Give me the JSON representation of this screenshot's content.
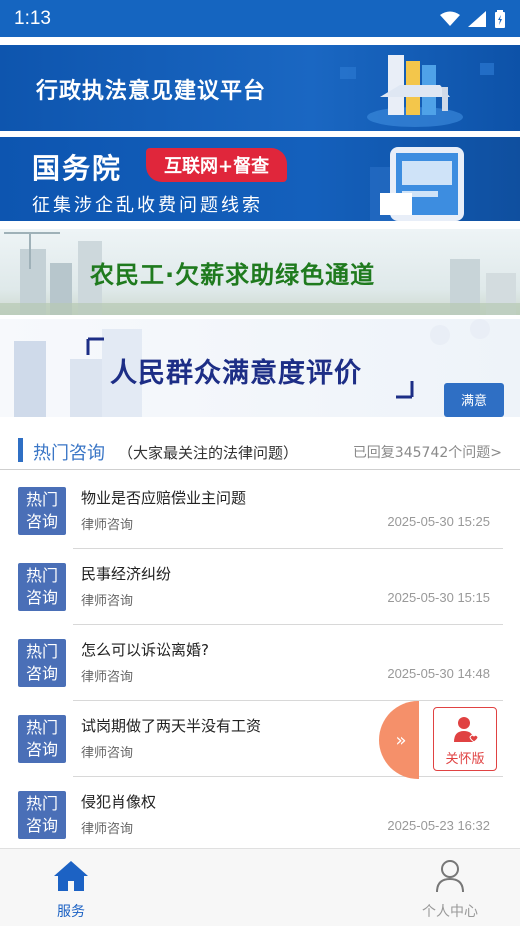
{
  "status_bar": {
    "time": "1:13"
  },
  "banners": [
    {
      "text": "行政执法意见建议平台"
    },
    {
      "title": "国务院",
      "tag": "互联网+督查",
      "subtitle": "征集涉企乱收费问题线索"
    },
    {
      "text": "农民工·欠薪求助绿色通道"
    },
    {
      "text": "人民群众满意度评价",
      "badge_text": "满意"
    }
  ],
  "section": {
    "title": "热门咨询",
    "subtitle": "（大家最关注的法律问题）",
    "count_text": "已回复345742个问题>"
  },
  "consultations": [
    {
      "badge": "热门咨询",
      "question": "物业是否应赔偿业主问题",
      "source": "律师咨询",
      "time": "2025-05-30 15:25"
    },
    {
      "badge": "热门咨询",
      "question": "民事经济纠纷",
      "source": "律师咨询",
      "time": "2025-05-30 15:15"
    },
    {
      "badge": "热门咨询",
      "question": "怎么可以诉讼离婚?",
      "source": "律师咨询",
      "time": "2025-05-30 14:48"
    },
    {
      "badge": "热门咨询",
      "question": "试岗期做了两天半没有工资",
      "source": "律师咨询",
      "time": ""
    },
    {
      "badge": "热门咨询",
      "question": "侵犯肖像权",
      "source": "律师咨询",
      "time": "2025-05-23 16:32"
    }
  ],
  "float": {
    "arrow": "»",
    "care_label": "关怀版"
  },
  "tabbar": {
    "items": [
      {
        "label": "服务",
        "icon": "home-icon",
        "active": true
      },
      {
        "label": "个人中心",
        "icon": "person-icon",
        "active": false
      }
    ]
  },
  "colors": {
    "status_bar": "#1565c0",
    "accent": "#3a76c6",
    "badge": "#4a6fb7",
    "care": "#e04242",
    "float_tab": "#f5906a"
  }
}
